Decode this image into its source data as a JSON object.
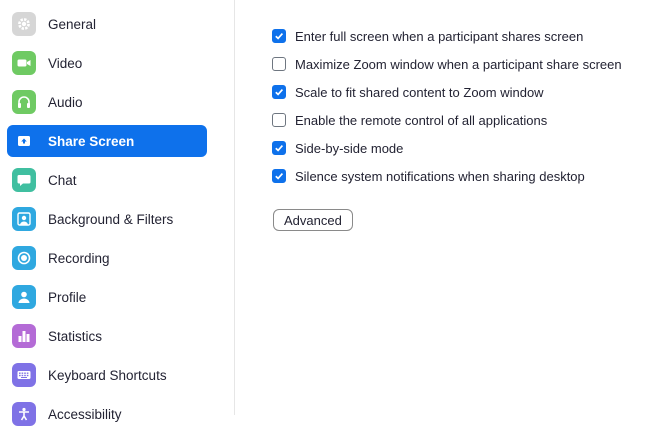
{
  "sidebar": {
    "items": [
      {
        "label": "General",
        "icon": "gear-icon",
        "color": "#d6d6d6"
      },
      {
        "label": "Video",
        "icon": "video-camera-icon",
        "color": "#6fca63"
      },
      {
        "label": "Audio",
        "icon": "headphones-icon",
        "color": "#6fca63"
      },
      {
        "label": "Share Screen",
        "icon": "share-screen-icon",
        "color": "#ffffff",
        "selected": true
      },
      {
        "label": "Chat",
        "icon": "chat-bubble-icon",
        "color": "#40bfa0"
      },
      {
        "label": "Background & Filters",
        "icon": "person-background-icon",
        "color": "#2fa8e0"
      },
      {
        "label": "Recording",
        "icon": "record-icon",
        "color": "#2fa8e0"
      },
      {
        "label": "Profile",
        "icon": "profile-icon",
        "color": "#2fa8e0"
      },
      {
        "label": "Statistics",
        "icon": "bar-chart-icon",
        "color": "#b46bd6"
      },
      {
        "label": "Keyboard Shortcuts",
        "icon": "keyboard-icon",
        "color": "#7f72e6"
      },
      {
        "label": "Accessibility",
        "icon": "accessibility-icon",
        "color": "#7f72e6"
      }
    ]
  },
  "share_screen": {
    "options": [
      {
        "label": "Enter full screen when a participant shares screen",
        "checked": true
      },
      {
        "label": "Maximize Zoom window when a participant share screen",
        "checked": false
      },
      {
        "label": "Scale to fit shared content to Zoom window",
        "checked": true
      },
      {
        "label": "Enable the remote control of all applications",
        "checked": false
      },
      {
        "label": "Side-by-side mode",
        "checked": true
      },
      {
        "label": "Silence system notifications when sharing desktop",
        "checked": true
      }
    ],
    "advanced_label": "Advanced"
  },
  "colors": {
    "accent": "#0e71eb"
  }
}
